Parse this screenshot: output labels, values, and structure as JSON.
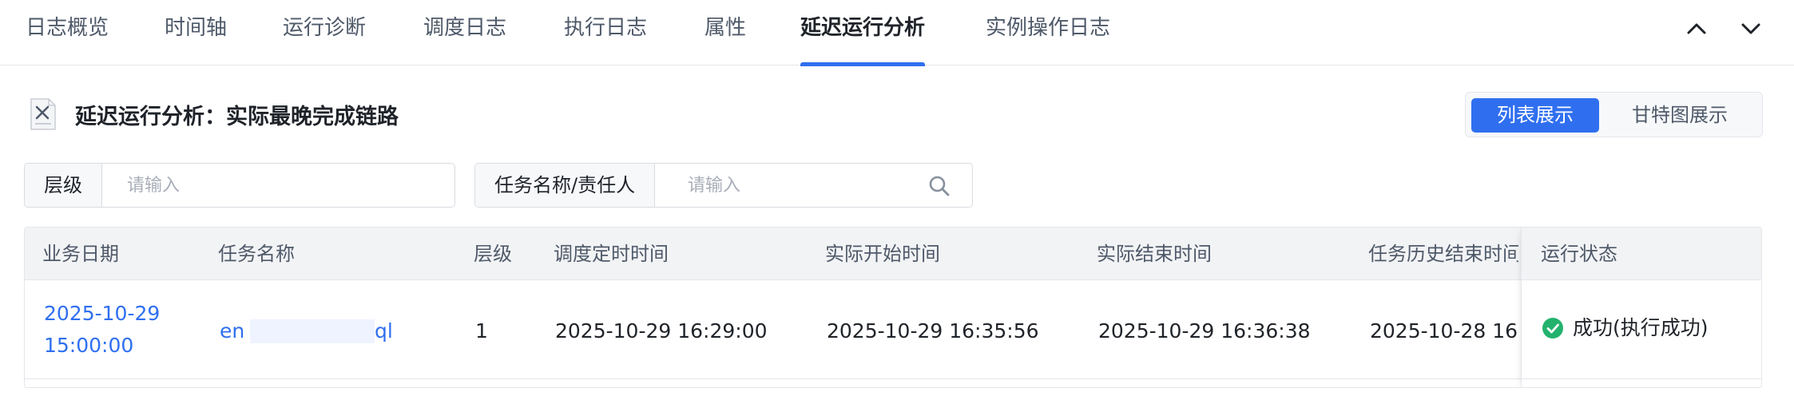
{
  "tabs": [
    {
      "label": "日志概览",
      "active": false
    },
    {
      "label": "时间轴",
      "active": false
    },
    {
      "label": "运行诊断",
      "active": false
    },
    {
      "label": "调度日志",
      "active": false
    },
    {
      "label": "执行日志",
      "active": false
    },
    {
      "label": "属性",
      "active": false
    },
    {
      "label": "延迟运行分析",
      "active": true
    },
    {
      "label": "实例操作日志",
      "active": false
    }
  ],
  "nav_icons": [
    "chevron-up-icon",
    "chevron-down-icon"
  ],
  "section": {
    "title": "延迟运行分析：实际最晚完成链路",
    "icon": "document-icon"
  },
  "view_switch": {
    "list_label": "列表展示",
    "gantt_label": "甘特图展示",
    "selected": "列表展示"
  },
  "filters": {
    "level_label": "层级",
    "level_placeholder": "请输入",
    "task_label": "任务名称/责任人",
    "task_placeholder": "请输入",
    "search_icon": "search-icon"
  },
  "table": {
    "columns": [
      "业务日期",
      "任务名称",
      "层级",
      "调度定时时间",
      "实际开始时间",
      "实际结束时间",
      "任务历史结束时间",
      "运行状态"
    ],
    "rows": [
      {
        "biz_date_line1": "2025-10-29",
        "biz_date_line2": "15:00:00",
        "task_name_start": "en",
        "task_name_end": "ql",
        "level": "1",
        "scheduled_time": "2025-10-29 16:29:00",
        "actual_start": "2025-10-29 16:35:56",
        "actual_end": "2025-10-29 16:36:38",
        "history_end": "2025-10-28 16",
        "status": "成功(执行成功)"
      }
    ]
  },
  "colors": {
    "accent": "#2f6fef",
    "success": "#23b26d",
    "header_bg": "#f2f3f5"
  }
}
